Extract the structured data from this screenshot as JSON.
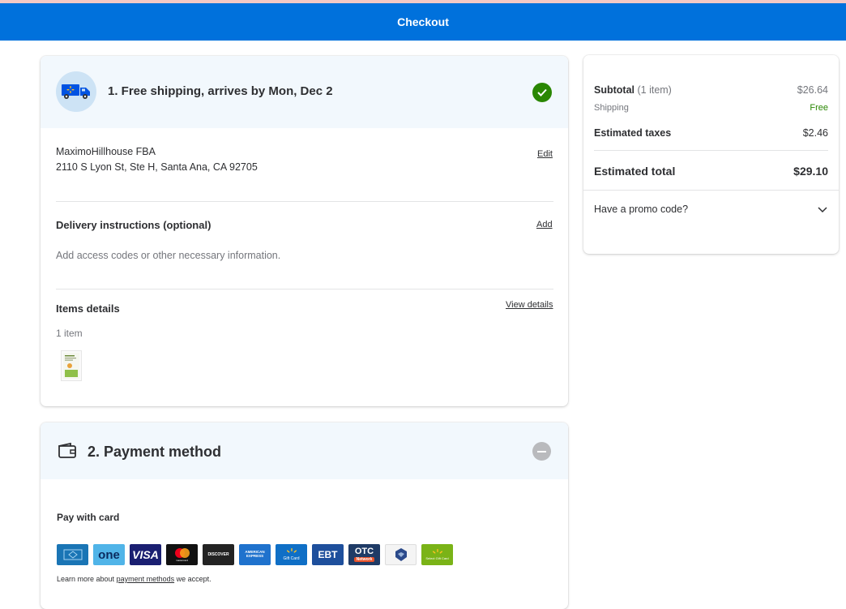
{
  "header": {
    "title": "Checkout"
  },
  "shipping": {
    "title": "1. Free shipping, arrives by Mon, Dec 2",
    "address_name": "MaximoHillhouse FBA",
    "address_line": "2110 S Lyon St, Ste H, Santa Ana, CA 92705",
    "edit_label": "Edit",
    "delivery_title": "Delivery instructions (optional)",
    "delivery_add_label": "Add",
    "delivery_placeholder": "Add access codes or other necessary information.",
    "items_title": "Items details",
    "view_details_label": "View details",
    "items_count": "1 item"
  },
  "payment": {
    "title": "2. Payment method",
    "pay_with_card": "Pay with card",
    "cards": [
      {
        "name": "walmart-credit-card",
        "label": "",
        "bg": "#1a75b5"
      },
      {
        "name": "one-card",
        "label": "one",
        "bg": "#50b4e8"
      },
      {
        "name": "visa-card",
        "label": "VISA",
        "bg": "#1a1f71"
      },
      {
        "name": "mastercard-card",
        "label": "mastercard",
        "bg": "#111111"
      },
      {
        "name": "discover-card",
        "label": "DISCOVER",
        "bg": "#232323"
      },
      {
        "name": "amex-card",
        "label": "AMERICAN EXPRESS",
        "bg": "#1f72cd"
      },
      {
        "name": "gift-card",
        "label": "Gift Card",
        "bg": "#0f6fc6"
      },
      {
        "name": "ebt-card",
        "label": "EBT",
        "bg": "#1e4f9c"
      },
      {
        "name": "otc-card",
        "label": "OTC",
        "sub": "Network",
        "bg": "#1f3b66"
      },
      {
        "name": "benefit-card",
        "label": "",
        "bg": "#f4f4f4"
      },
      {
        "name": "select-gift-card",
        "label": "Select Gift Card",
        "bg": "#7ab317"
      }
    ],
    "learn_prefix": "Learn more about",
    "learn_link": "payment methods",
    "learn_suffix": "we accept."
  },
  "summary": {
    "subtotal_label": "Subtotal",
    "subtotal_count": "(1 item)",
    "subtotal_value": "$26.64",
    "shipping_label": "Shipping",
    "shipping_value": "Free",
    "taxes_label": "Estimated taxes",
    "taxes_value": "$2.46",
    "total_label": "Estimated total",
    "total_value": "$29.10",
    "promo_label": "Have a promo code?"
  },
  "colors": {
    "brand_blue": "#0071dc",
    "success_green": "#2a8703",
    "section_bg": "#f2f8fd"
  }
}
